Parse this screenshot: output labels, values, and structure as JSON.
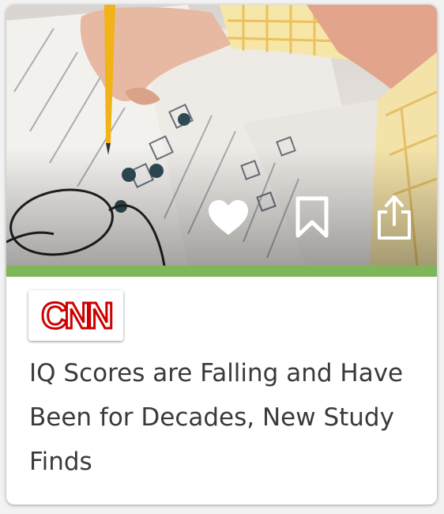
{
  "article": {
    "source": "CNN",
    "headline": "IQ Scores are Falling and Have Been for Decades, New Study Finds",
    "image_description_icon": "photo-icon"
  },
  "actions": {
    "like_icon": "heart-icon",
    "bookmark_icon": "bookmark-icon",
    "share_icon": "share-icon"
  },
  "colors": {
    "accent_bar": "#7fb65a",
    "logo_red": "#cc0000",
    "headline_text": "#3a3a3a"
  }
}
